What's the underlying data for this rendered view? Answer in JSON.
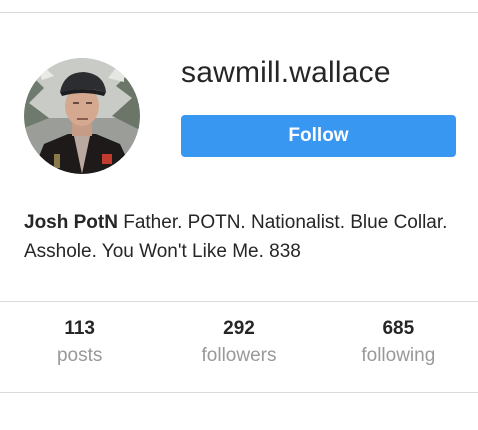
{
  "profile": {
    "username": "sawmill.wallace",
    "follow_label": "Follow",
    "bio_name": "Josh PotN",
    "bio_text": "Father. POTN. Nationalist. Blue Collar. Asshole. You Won't Like Me. 838"
  },
  "stats": [
    {
      "value": "113",
      "label": "posts"
    },
    {
      "value": "292",
      "label": "followers"
    },
    {
      "value": "685",
      "label": "following"
    }
  ],
  "colors": {
    "accent": "#3897f0",
    "muted": "#999999",
    "divider": "#dbdbdb"
  }
}
